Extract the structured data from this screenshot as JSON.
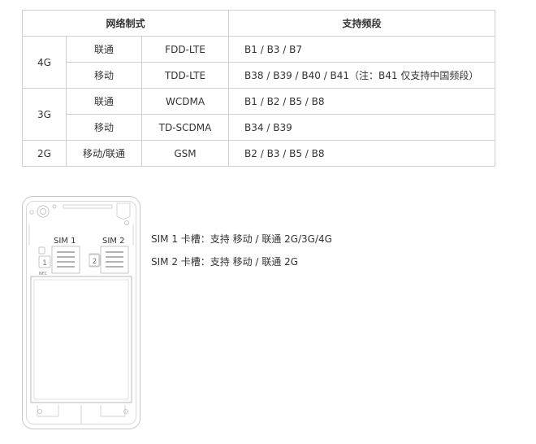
{
  "table": {
    "headers": {
      "network": "网络制式",
      "bands": "支持频段"
    },
    "groups": [
      {
        "gen": "4G",
        "rows": [
          {
            "carrier": "联通",
            "standard": "FDD-LTE",
            "bands": "B1 / B3 / B7"
          },
          {
            "carrier": "移动",
            "standard": "TDD-LTE",
            "bands": "B38 / B39 / B40 / B41（注：B41 仅支持中国频段）"
          }
        ]
      },
      {
        "gen": "3G",
        "rows": [
          {
            "carrier": "联通",
            "standard": "WCDMA",
            "bands": "B1 / B2 / B5 / B8"
          },
          {
            "carrier": "移动",
            "standard": "TD-SCDMA",
            "bands": "B34 / B39"
          }
        ]
      },
      {
        "gen": "2G",
        "rows": [
          {
            "carrier": "移动/联通",
            "standard": "GSM",
            "bands": "B2 / B3 / B5 / B8"
          }
        ]
      }
    ]
  },
  "diagram": {
    "sim1_label": "SIM 1",
    "sim2_label": "SIM 2",
    "slot1_num": "1",
    "slot2_num": "2",
    "nfc_label": "NFC"
  },
  "notes": {
    "sim1": "SIM 1 卡槽：支持 移动 / 联通 2G/3G/4G",
    "sim2": "SIM 2 卡槽：支持 移动 / 联通 2G"
  }
}
